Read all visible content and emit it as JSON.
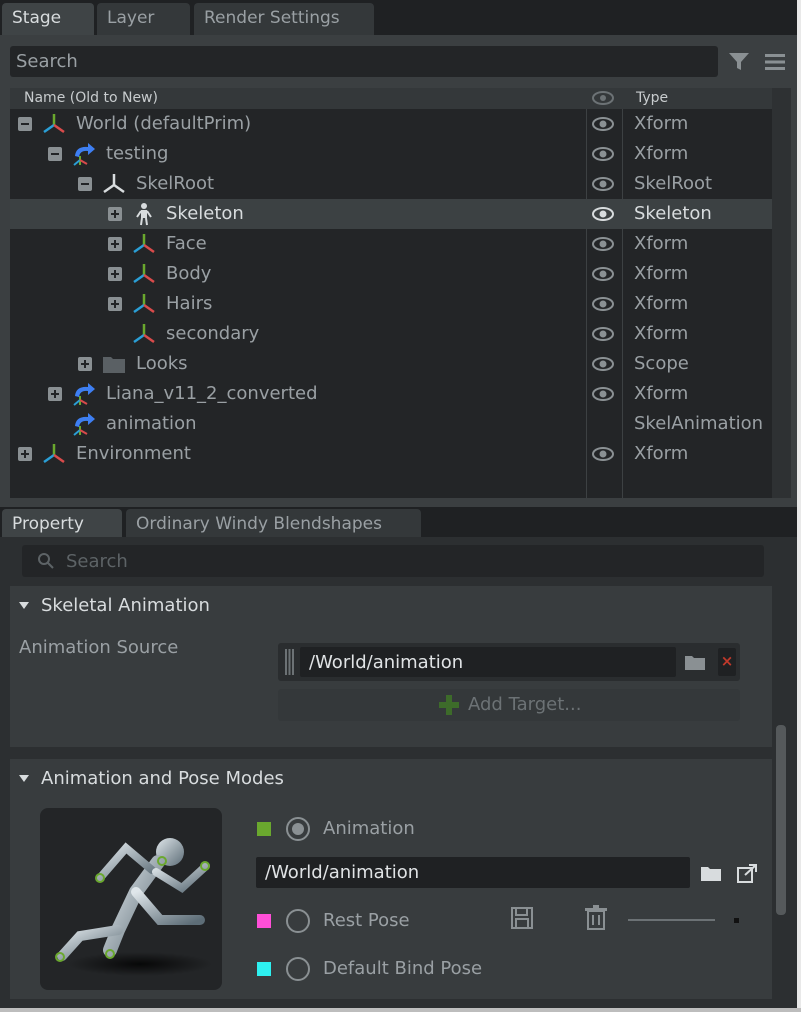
{
  "stage": {
    "tabs": [
      "Stage",
      "Layer",
      "Render Settings"
    ],
    "search_placeholder": "Search",
    "columns": {
      "name": "Name (Old to New)",
      "type": "Type"
    },
    "rows": [
      {
        "label": "World (defaultPrim)",
        "type": "Xform",
        "icon": "xform-axis-icon",
        "expander": "minus",
        "visible": true
      },
      {
        "label": "testing",
        "type": "Xform",
        "icon": "reference-arrow-icon",
        "expander": "minus",
        "visible": true
      },
      {
        "label": "SkelRoot",
        "type": "SkelRoot",
        "icon": "skelroot-icon",
        "expander": "minus",
        "visible": true
      },
      {
        "label": "Skeleton",
        "type": "Skeleton",
        "icon": "skeleton-figure-icon",
        "expander": "plus",
        "visible": true,
        "selected": true
      },
      {
        "label": "Face",
        "type": "Xform",
        "icon": "xform-axis-icon",
        "expander": "plus",
        "visible": true
      },
      {
        "label": "Body",
        "type": "Xform",
        "icon": "xform-axis-icon",
        "expander": "plus",
        "visible": true
      },
      {
        "label": "Hairs",
        "type": "Xform",
        "icon": "xform-axis-icon",
        "expander": "plus",
        "visible": true
      },
      {
        "label": "secondary",
        "type": "Xform",
        "icon": "xform-axis-icon",
        "expander": "none",
        "visible": true
      },
      {
        "label": "Looks",
        "type": "Scope",
        "icon": "folder-icon",
        "expander": "plus",
        "visible": true
      },
      {
        "label": "Liana_v11_2_converted",
        "type": "Xform",
        "icon": "reference-arrow-icon",
        "expander": "plus",
        "visible": true
      },
      {
        "label": "animation",
        "type": "SkelAnimation",
        "icon": "animation-arrow-icon",
        "expander": "none",
        "visible": false
      },
      {
        "label": "Environment",
        "type": "Xform",
        "icon": "xform-axis-icon",
        "expander": "plus",
        "visible": true
      }
    ]
  },
  "property": {
    "tabs": [
      "Property",
      "Ordinary Windy Blendshapes"
    ],
    "search_placeholder": "Search",
    "skeletal_animation": {
      "title": "Skeletal Animation",
      "source_label": "Animation Source",
      "target_path": "/World/animation",
      "remove_glyph": "×",
      "add_target_label": "Add Target..."
    },
    "modes": {
      "title": "Animation and Pose Modes",
      "animation_label": "Animation",
      "animation_path": "/World/animation",
      "rest_pose_label": "Rest Pose",
      "bind_pose_label": "Default Bind Pose",
      "colors": {
        "animation": "#6aa82e",
        "rest_pose": "#ff4fd8",
        "bind_pose": "#2ef0f0"
      }
    }
  },
  "colors": {
    "panel": "#3b3f41",
    "tree_bg": "#232527",
    "accent_red": "#c0392b"
  }
}
